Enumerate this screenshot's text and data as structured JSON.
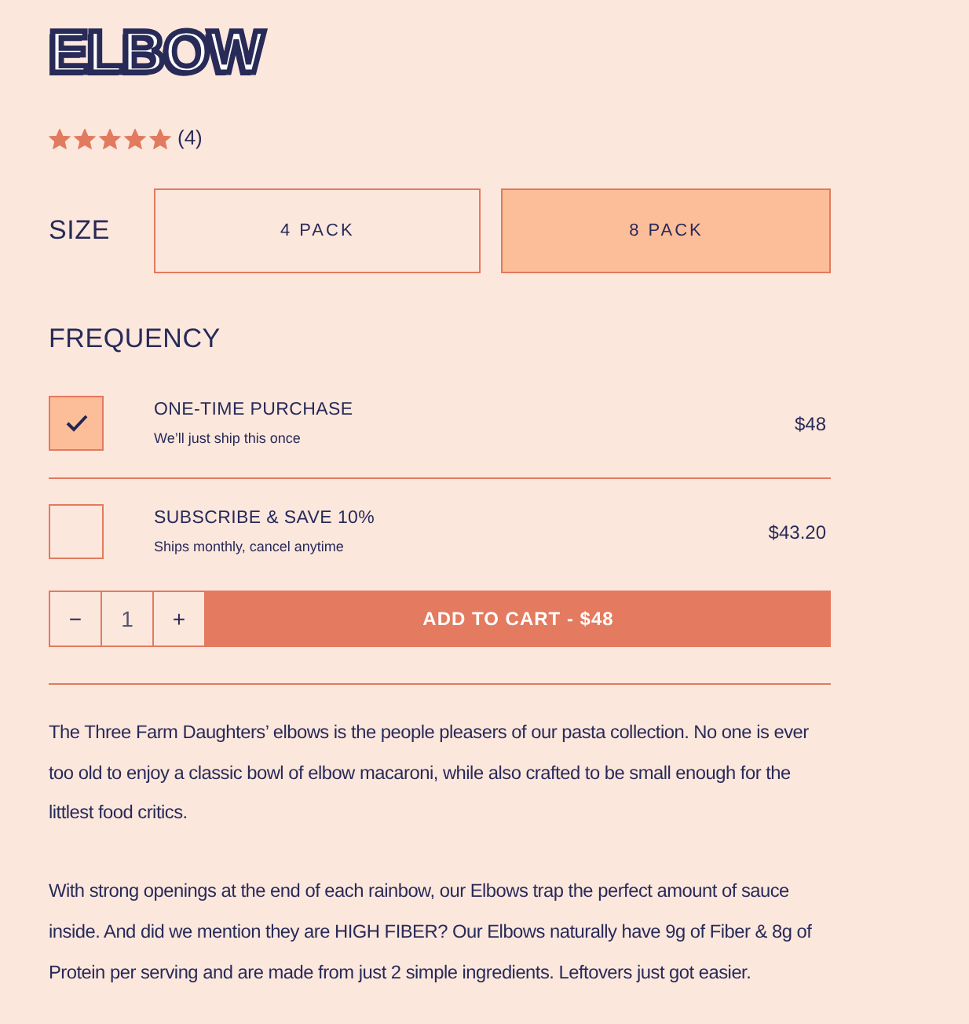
{
  "product": {
    "title": "ELBOW",
    "stars": 5,
    "review_count": "(4)"
  },
  "size": {
    "label": "SIZE",
    "options": [
      {
        "label": "4 PACK",
        "selected": false
      },
      {
        "label": "8 PACK",
        "selected": true
      }
    ]
  },
  "frequency": {
    "label": "FREQUENCY",
    "options": [
      {
        "title": "ONE-TIME PURCHASE",
        "subtitle": "We’ll just ship this once",
        "price": "$48",
        "selected": true
      },
      {
        "title": "SUBSCRIBE & SAVE 10%",
        "subtitle": "Ships monthly, cancel anytime",
        "price": "$43.20",
        "selected": false
      }
    ]
  },
  "cart": {
    "decrement": "−",
    "quantity": "1",
    "increment": "+",
    "button": "ADD TO CART - $48"
  },
  "description": [
    "The Three Farm Daughters’ elbows is the people pleasers of our pasta collection. No one is ever too old to enjoy a classic bowl of elbow macaroni, while also crafted to be small enough for the littlest food critics.",
    "With strong openings at the end of each rainbow, our Elbows trap the perfect amount of sauce inside. And did we mention they are HIGH FIBER? Our Elbows naturally have 9g of Fiber & 8g of Protein per serving and are made from just 2 simple ingredients. Leftovers just got easier."
  ]
}
